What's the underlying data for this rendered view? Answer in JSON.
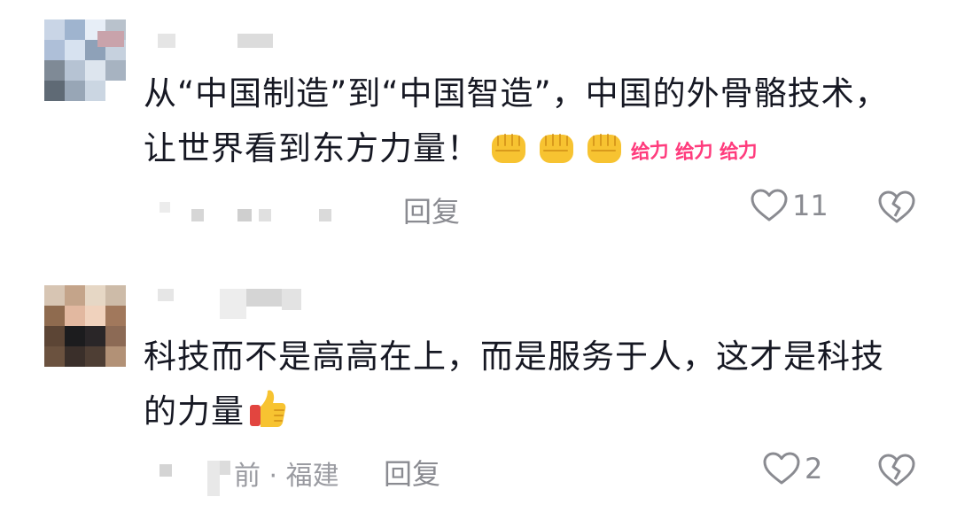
{
  "comments": [
    {
      "text_line1": "从“中国制造”到“中国智造”，中国的外骨骼技术，",
      "text_line2": "让世界看到东方力量！",
      "stickers": [
        "给力",
        "给力",
        "给力"
      ],
      "reply_label": "回复",
      "like_count": "11",
      "icons": [
        "avatar-blurred",
        "fist-emoji",
        "heart-outline-icon",
        "broken-heart-icon"
      ]
    },
    {
      "text_line1": "科技而不是高高在上，而是服务于人，这才是科技",
      "text_line2": "的力量",
      "meta_partial": "前 · 福建",
      "reply_label": "回复",
      "like_count": "2",
      "icons": [
        "avatar-blurred",
        "thumbs-up-emoji",
        "heart-outline-icon",
        "broken-heart-icon"
      ]
    }
  ],
  "colors": {
    "text": "#161823",
    "secondary": "#8a8b91",
    "sticker": "#ff3c7d",
    "fist": "#f7c331"
  }
}
